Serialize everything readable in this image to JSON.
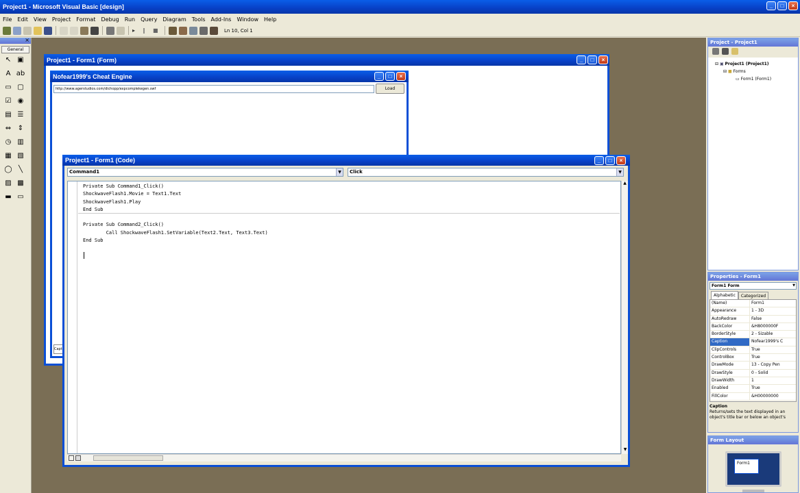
{
  "app": {
    "title": "Project1 - Microsoft Visual Basic [design]",
    "status_position": "Ln 10, Col 1"
  },
  "menu": [
    "File",
    "Edit",
    "View",
    "Project",
    "Format",
    "Debug",
    "Run",
    "Query",
    "Diagram",
    "Tools",
    "Add-Ins",
    "Window",
    "Help"
  ],
  "toolbox": {
    "title": "General",
    "tools": [
      "pointer-icon",
      "picturebox-icon",
      "label-icon",
      "textbox-icon",
      "frame-icon",
      "commandbutton-icon",
      "checkbox-icon",
      "optionbutton-icon",
      "combobox-icon",
      "listbox-icon",
      "hscrollbar-icon",
      "vscrollbar-icon",
      "timer-icon",
      "drivelist-icon",
      "dirlist-icon",
      "filelist-icon",
      "shape-icon",
      "line-icon",
      "image-icon",
      "data-icon",
      "ole-icon",
      "flash-icon"
    ]
  },
  "form_designer": {
    "title": "Project1 - Form1 (Form)",
    "form": {
      "caption": "Nofear1999's Cheat Engine",
      "url_value": "http://www.agerstudios.com/dichopp/expcomplekegen.swf",
      "load_label": "Load",
      "bottom_stub": "Caption"
    }
  },
  "code_window": {
    "title": "Project1 - Form1 (Code)",
    "object_combo": "Command1",
    "proc_combo": "Click",
    "lines": [
      "Private Sub Command1_Click()",
      "ShockwaveFlash1.Movie = Text1.Text",
      "ShockwaveFlash1.Play",
      "End Sub",
      "",
      "Private Sub Command2_Click()",
      "        Call ShockwaveFlash1.SetVariable(Text2.Text, Text3.Text)",
      "End Sub",
      "",
      ""
    ]
  },
  "project_explorer": {
    "title": "Project - Project1",
    "root": "Project1 (Project1)",
    "folder": "Forms",
    "item": "Form1 (Form1)"
  },
  "properties": {
    "title": "Properties - Form1",
    "object": "Form1 Form",
    "tab_alpha": "Alphabetic",
    "tab_cat": "Categorized",
    "rows": [
      {
        "k": "(Name)",
        "v": "Form1"
      },
      {
        "k": "Appearance",
        "v": "1 - 3D"
      },
      {
        "k": "AutoRedraw",
        "v": "False"
      },
      {
        "k": "BackColor",
        "v": "&H8000000F"
      },
      {
        "k": "BorderStyle",
        "v": "2 - Sizable"
      },
      {
        "k": "Caption",
        "v": "Nofear1999's C"
      },
      {
        "k": "ClipControls",
        "v": "True"
      },
      {
        "k": "ControlBox",
        "v": "True"
      },
      {
        "k": "DrawMode",
        "v": "13 - Copy Pen"
      },
      {
        "k": "DrawStyle",
        "v": "0 - Solid"
      },
      {
        "k": "DrawWidth",
        "v": "1"
      },
      {
        "k": "Enabled",
        "v": "True"
      },
      {
        "k": "FillColor",
        "v": "&H00000000"
      }
    ],
    "selected": "Caption",
    "desc_title": "Caption",
    "desc_text": "Returns/sets the text displayed in an object's title bar or below an object's"
  },
  "form_layout": {
    "title": "Form Layout",
    "preview_label": "Form1"
  }
}
